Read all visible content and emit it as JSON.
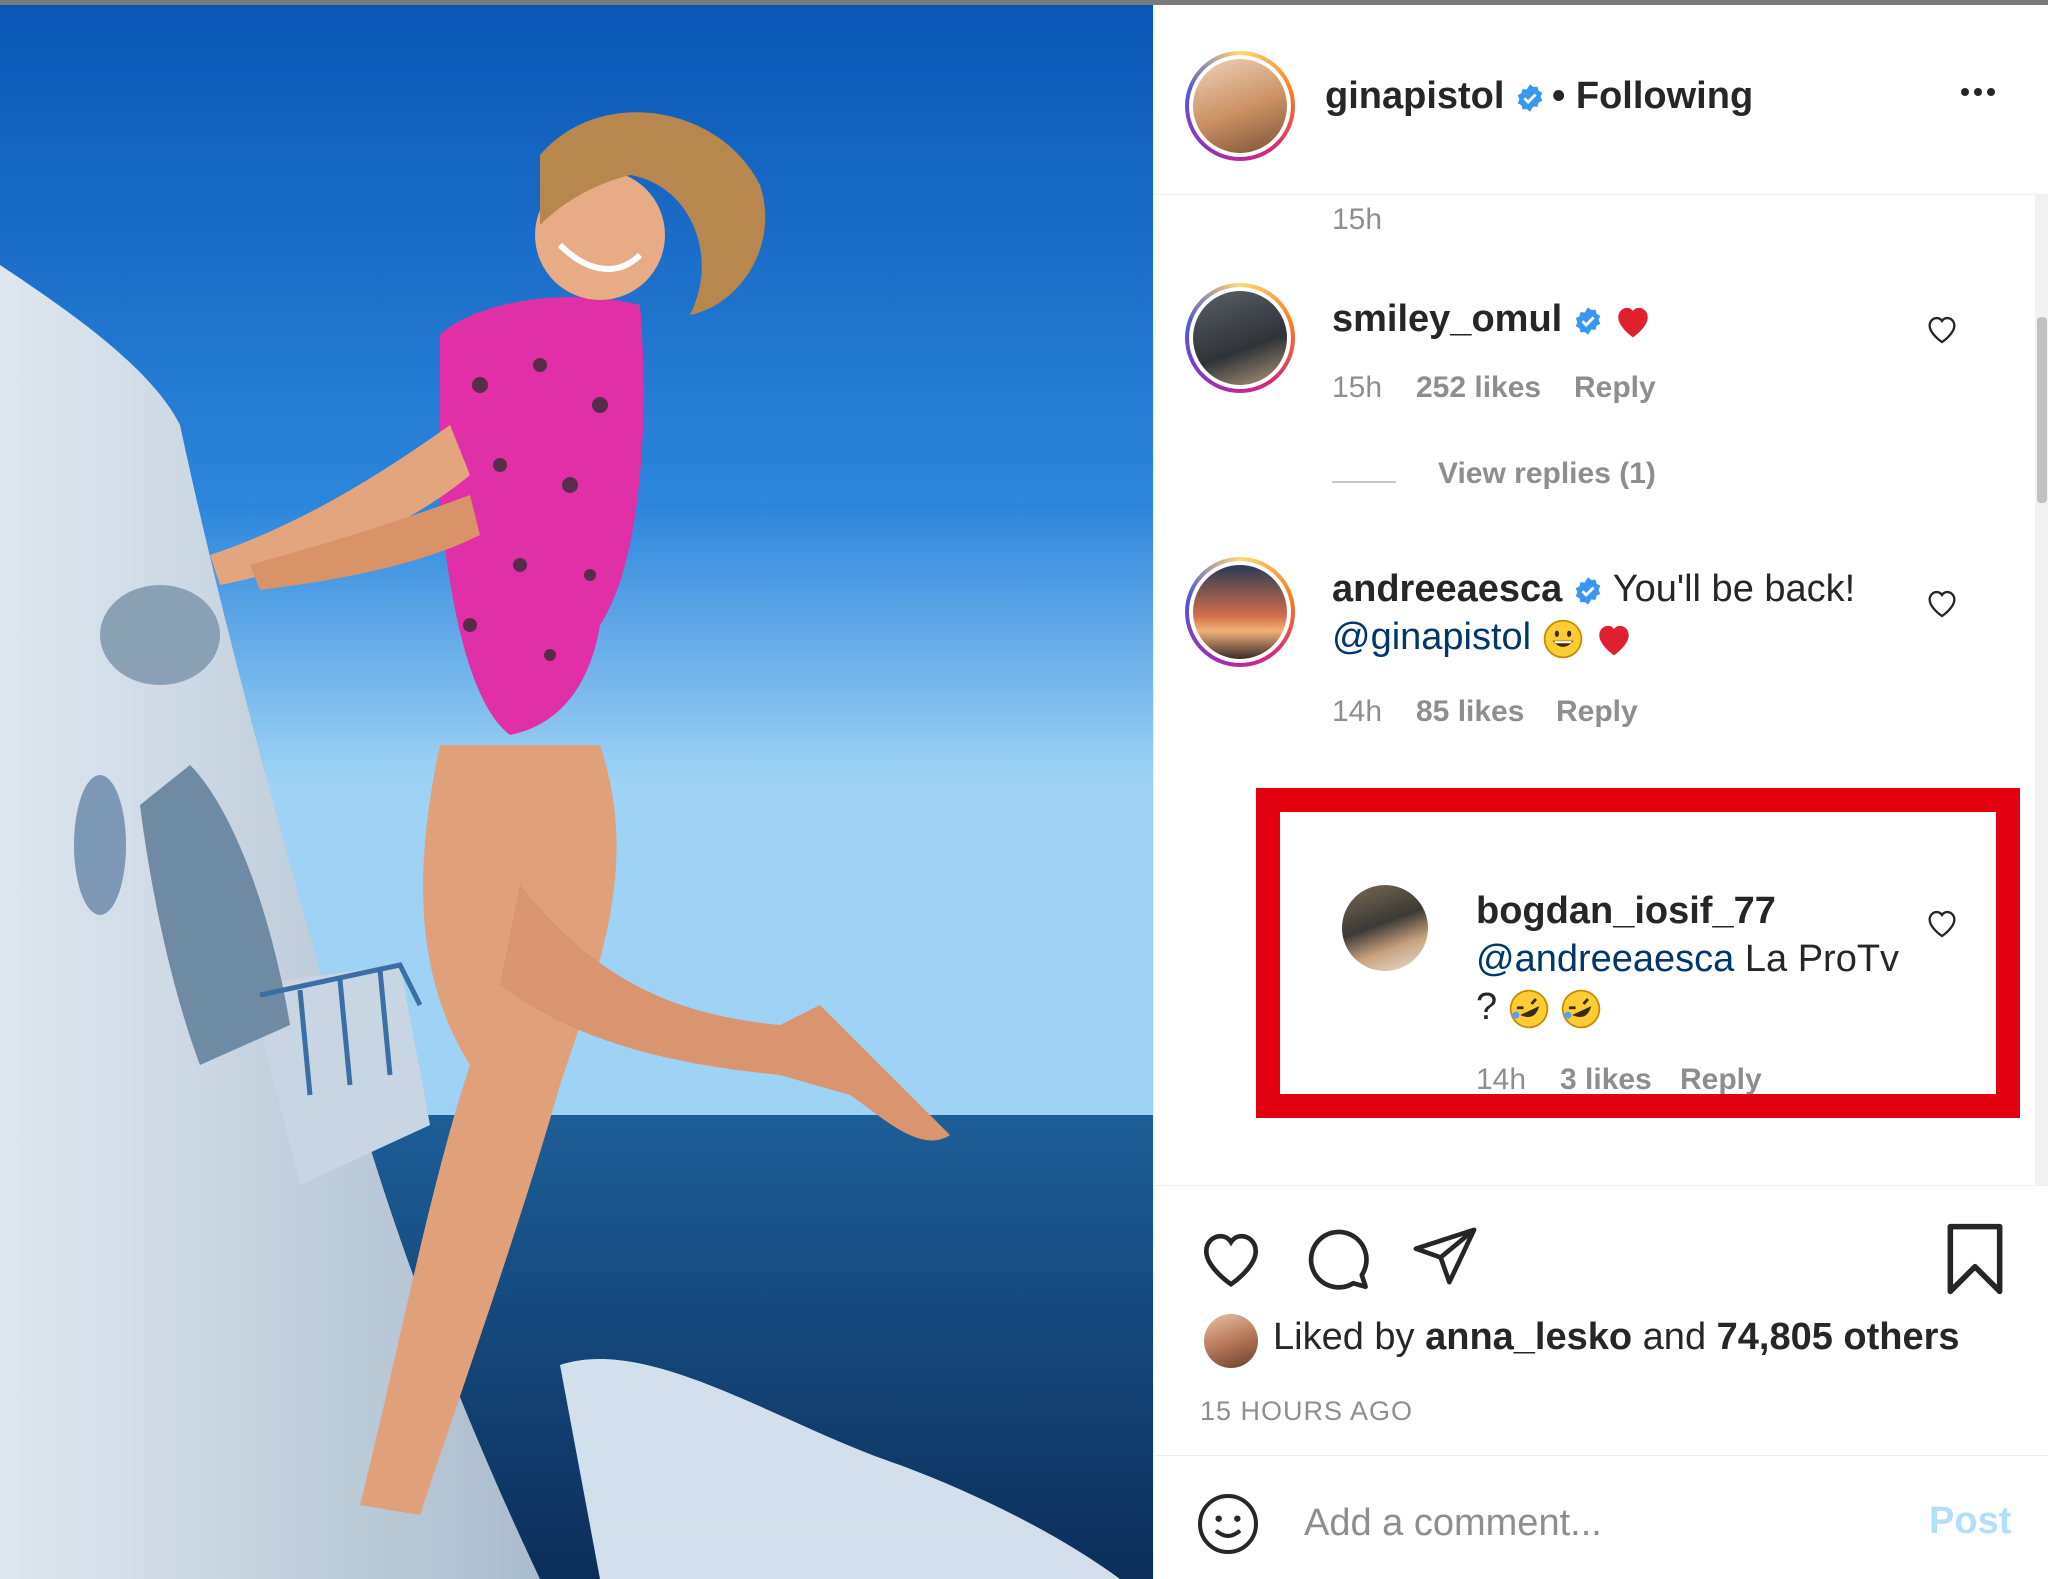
{
  "post": {
    "author": "ginapistol",
    "follow_status": "• Following",
    "more_label": "•••"
  },
  "comments_top_time": "15h",
  "comments": [
    {
      "username": "smiley_omul",
      "text": "",
      "time": "15h",
      "likes": "252 likes",
      "reply": "Reply",
      "view_replies": "View replies (1)"
    },
    {
      "username": "andreeaesca",
      "text": "You'll be back!",
      "mention": "@ginapistol",
      "time": "14h",
      "likes": "85 likes",
      "reply": "Reply"
    }
  ],
  "highlighted_reply": {
    "username": "bogdan_iosif_77",
    "mention": "@andreeaesca",
    "text": "La ProTv",
    "text2": "?",
    "time": "14h",
    "likes": "3 likes",
    "reply": "Reply"
  },
  "likes_summary": {
    "prefix": "Liked by",
    "user": "anna_lesko",
    "middle": "and",
    "count": "74,805 others"
  },
  "time_ago": "15 HOURS AGO",
  "add_comment": {
    "placeholder": "Add a comment...",
    "post_label": "Post"
  },
  "colors": {
    "highlight_box": "#e3000f",
    "verified": "#3897f0",
    "link": "#00376b",
    "muted": "#8e8e8e"
  }
}
